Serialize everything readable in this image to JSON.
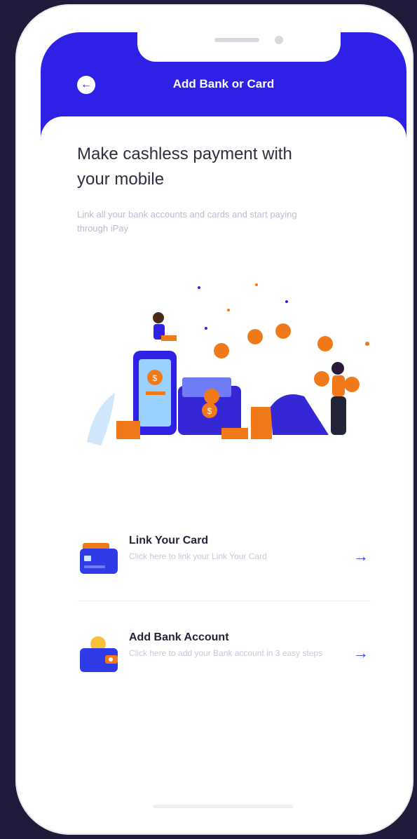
{
  "header": {
    "title": "Add Bank or Card",
    "back_icon": "arrow-left-icon"
  },
  "intro": {
    "headline": "Make cashless payment with your mobile",
    "subtitle": "Link all your bank accounts and cards and start paying through iPay"
  },
  "options": [
    {
      "title": "Link Your Card",
      "description": "Click here to link your Link Your Card",
      "icon": "card-wallet-icon",
      "arrow_icon": "arrow-right-icon"
    },
    {
      "title": "Add Bank Account",
      "description": "Click here to add your Bank account in 3 easy steps",
      "icon": "wallet-coin-icon",
      "arrow_icon": "arrow-right-icon"
    }
  ],
  "colors": {
    "primary": "#2f20e6",
    "accent_orange": "#f07a1a",
    "background": "#1f1b3a"
  }
}
